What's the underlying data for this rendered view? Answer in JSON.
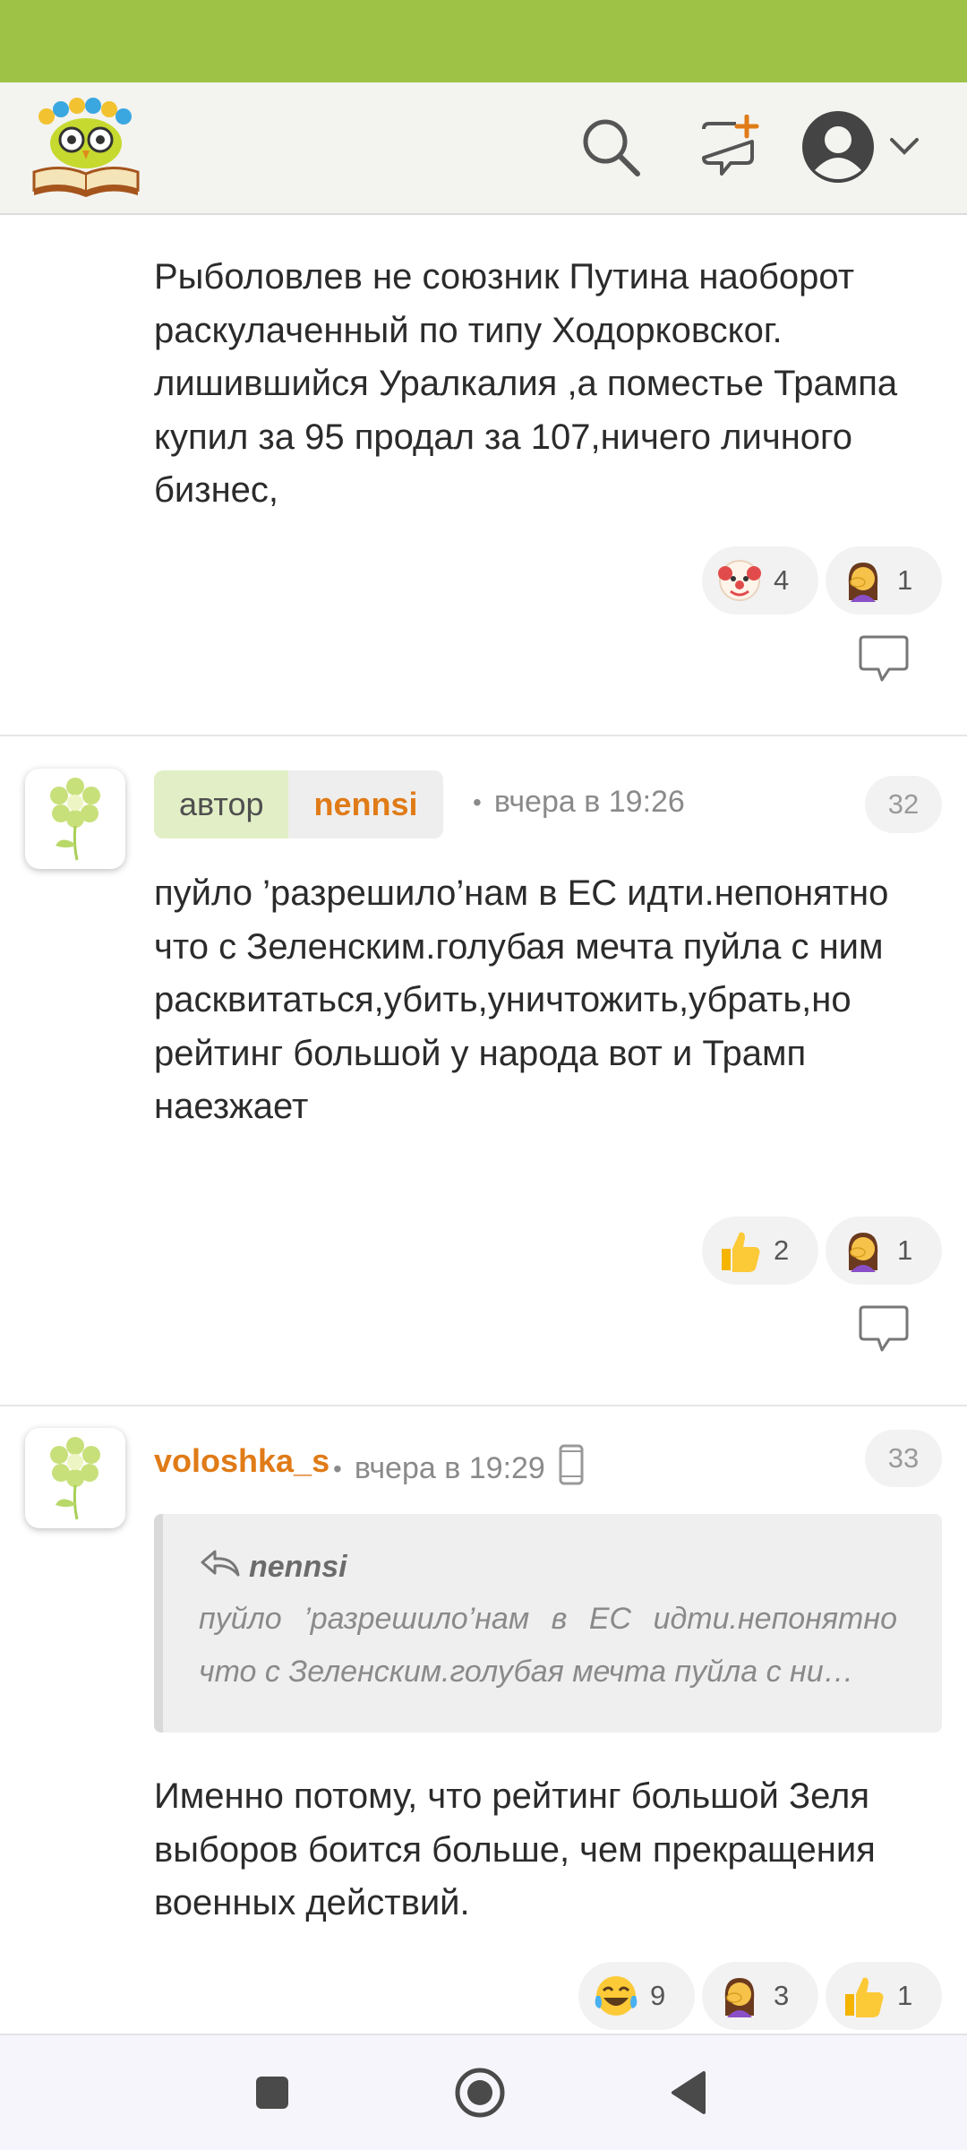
{
  "header": {
    "logo": "owl-with-book-logo",
    "search_icon": "search-icon",
    "new_post_icon": "new-post-icon",
    "account_icon": "account-icon"
  },
  "comments": [
    {
      "text": "Рыболовлев не союзник Путина наоборот раскулаченный по типу Ходорковског. лишившийся Уралкалия ,а поместье Трампа купил за 95 продал за 107,ничего личного бизнес,",
      "reactions": [
        {
          "icon": "clown-emoji",
          "count": "4"
        },
        {
          "icon": "facepalm-emoji",
          "count": "1"
        }
      ]
    },
    {
      "author_label": "автор",
      "username": "nennsi",
      "time": "вчера в 19:26",
      "number": "32",
      "text": "пуйло ’разрешило’нам в ЕС идти.непонятно что с Зеленским.голубая мечта пуйла с ним расквитаться,убить,уничтожить,убрать,но рейтинг большой у народа вот и Трамп наезжает",
      "reactions": [
        {
          "icon": "thumbs-up-emoji",
          "count": "2"
        },
        {
          "icon": "facepalm-emoji",
          "count": "1"
        }
      ]
    },
    {
      "username": "voloshka_s",
      "time": "вчера в 19:29",
      "number": "33",
      "quote_author": "nennsi",
      "quote_text": "пуйло ’разрешило’нам в ЕС идти.непонятно что с Зеленским.голубая мечта пуйла с ни…",
      "text": "Именно потому, что рейтинг большой Зеля выборов боится больше, чем прекращения военных действий.",
      "reactions": [
        {
          "icon": "tears-of-joy-emoji",
          "count": "9"
        },
        {
          "icon": "facepalm-emoji",
          "count": "3"
        },
        {
          "icon": "thumbs-up-emoji",
          "count": "1"
        }
      ]
    }
  ],
  "colors": {
    "status_bar": "#9dc246",
    "accent": "#e07b17",
    "author_label_bg": "#e2efc6"
  }
}
